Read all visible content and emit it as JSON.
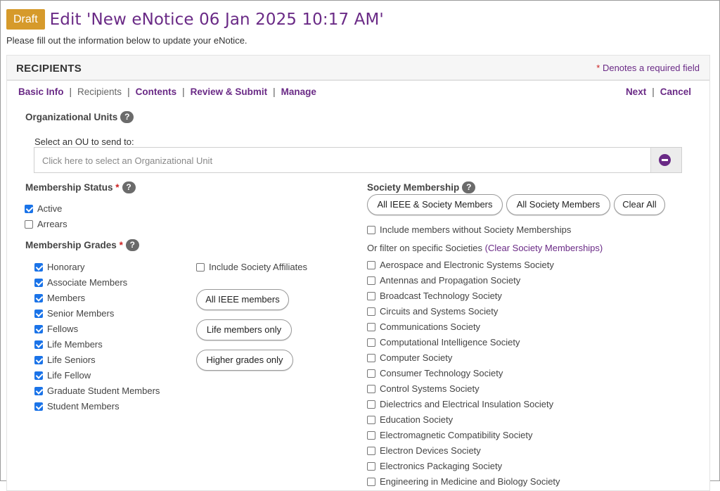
{
  "header": {
    "badge": "Draft",
    "title": "Edit 'New eNotice 06 Jan 2025 10:17 AM'",
    "subtitle": "Please fill out the information below to update your eNotice."
  },
  "panel": {
    "title": "RECIPIENTS",
    "required_star": "*",
    "required_note": " Denotes a required field"
  },
  "nav": {
    "items": [
      "Basic Info",
      "Recipients",
      "Contents",
      "Review & Submit",
      "Manage"
    ],
    "separator": "|",
    "current": "Recipients",
    "next": "Next",
    "cancel": "Cancel"
  },
  "ou": {
    "heading": "Organizational Units",
    "help": "?",
    "select_label": "Select an OU to send to:",
    "placeholder": "Click here to select an Organizational Unit",
    "button_icon": "minus-circle-icon"
  },
  "membership_status": {
    "heading": "Membership Status",
    "req": "*",
    "help": "?",
    "options": [
      {
        "label": "Active",
        "checked": true
      },
      {
        "label": "Arrears",
        "checked": false
      }
    ]
  },
  "membership_grades": {
    "heading": "Membership Grades",
    "req": "*",
    "help": "?",
    "options": [
      {
        "label": "Honorary",
        "checked": true
      },
      {
        "label": "Associate Members",
        "checked": true
      },
      {
        "label": "Members",
        "checked": true
      },
      {
        "label": "Senior Members",
        "checked": true
      },
      {
        "label": "Fellows",
        "checked": true
      },
      {
        "label": "Life Members",
        "checked": true
      },
      {
        "label": "Life Seniors",
        "checked": true
      },
      {
        "label": "Life Fellow",
        "checked": true
      },
      {
        "label": "Graduate Student Members",
        "checked": true
      },
      {
        "label": "Student Members",
        "checked": true
      }
    ],
    "include_affiliates": {
      "label": "Include Society Affiliates",
      "checked": false
    },
    "buttons": [
      "All IEEE members",
      "Life members only",
      "Higher grades only"
    ]
  },
  "society": {
    "heading": "Society Membership",
    "help": "?",
    "buttons": [
      "All IEEE & Society Members",
      "All Society Members",
      "Clear All"
    ],
    "include_without": {
      "label": "Include members without Society Memberships",
      "checked": false
    },
    "filter_text": "Or filter on specific Societies ",
    "clear_link": "(Clear Society Memberships)",
    "societies": [
      "Aerospace and Electronic Systems Society",
      "Antennas and Propagation Society",
      "Broadcast Technology Society",
      "Circuits and Systems Society",
      "Communications Society",
      "Computational Intelligence Society",
      "Computer Society",
      "Consumer Technology Society",
      "Control Systems Society",
      "Dielectrics and Electrical Insulation Society",
      "Education Society",
      "Electromagnetic Compatibility Society",
      "Electron Devices Society",
      "Electronics Packaging Society",
      "Engineering in Medicine and Biology Society"
    ]
  },
  "colors": {
    "brand_purple": "#6a2a86",
    "draft_badge": "#d69a2b",
    "required_red": "#cc2222",
    "checkbox_blue": "#1a73e8"
  }
}
